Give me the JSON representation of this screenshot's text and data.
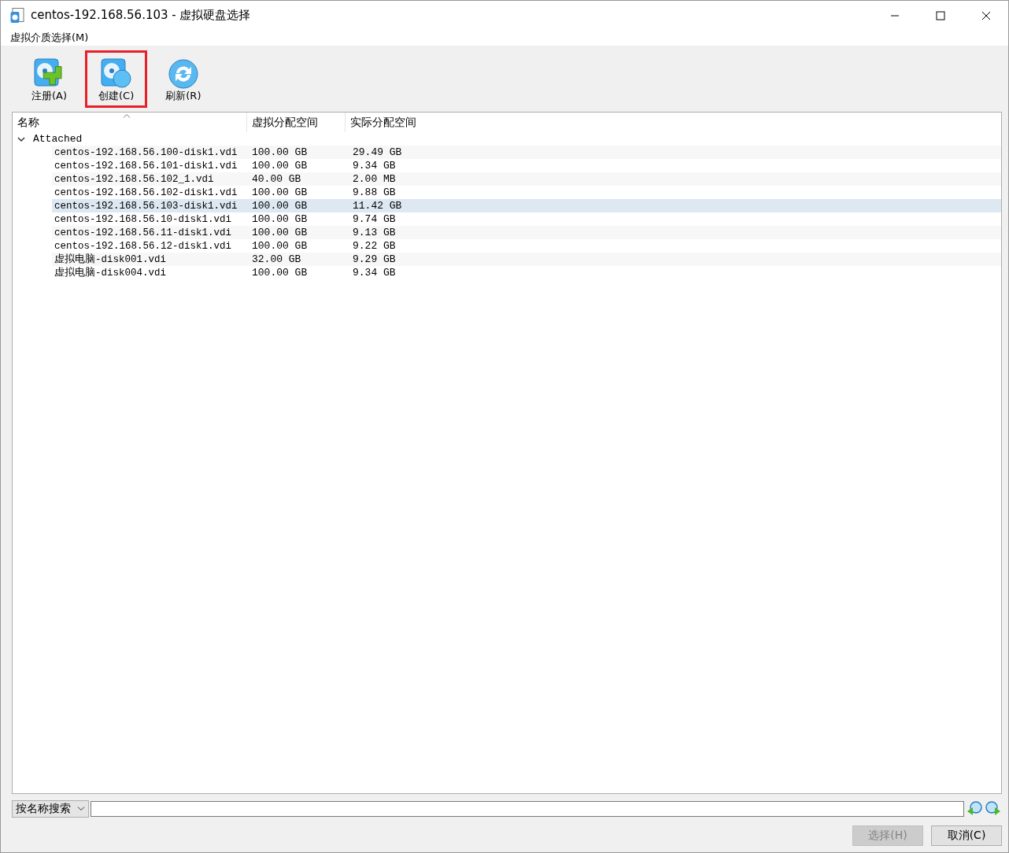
{
  "window": {
    "title": "centos-192.168.56.103 - 虚拟硬盘选择"
  },
  "menu": [
    {
      "label": "虚拟介质选择(M)"
    }
  ],
  "toolbar": [
    {
      "label": "注册(A)",
      "kind": "add",
      "highlighted": false
    },
    {
      "label": "创建(C)",
      "kind": "create",
      "highlighted": true
    },
    {
      "label": "刷新(R)",
      "kind": "refresh",
      "highlighted": false
    }
  ],
  "table": {
    "columns": [
      "名称",
      "虚拟分配空间",
      "实际分配空间"
    ],
    "groups": [
      {
        "label": "Attached",
        "expanded": true,
        "rows": [
          {
            "name": "centos-192.168.56.100-disk1.vdi",
            "virtual": "100.00 GB",
            "actual": "29.49 GB",
            "selected": false
          },
          {
            "name": "centos-192.168.56.101-disk1.vdi",
            "virtual": "100.00 GB",
            "actual": "9.34 GB",
            "selected": false
          },
          {
            "name": "centos-192.168.56.102_1.vdi",
            "virtual": "40.00 GB",
            "actual": "2.00 MB",
            "selected": false
          },
          {
            "name": "centos-192.168.56.102-disk1.vdi",
            "virtual": "100.00 GB",
            "actual": "9.88 GB",
            "selected": false
          },
          {
            "name": "centos-192.168.56.103-disk1.vdi",
            "virtual": "100.00 GB",
            "actual": "11.42 GB",
            "selected": true
          },
          {
            "name": "centos-192.168.56.10-disk1.vdi",
            "virtual": "100.00 GB",
            "actual": "9.74 GB",
            "selected": false
          },
          {
            "name": "centos-192.168.56.11-disk1.vdi",
            "virtual": "100.00 GB",
            "actual": "9.13 GB",
            "selected": false
          },
          {
            "name": "centos-192.168.56.12-disk1.vdi",
            "virtual": "100.00 GB",
            "actual": "9.22 GB",
            "selected": false
          },
          {
            "name": "虚拟电脑-disk001.vdi",
            "virtual": "32.00 GB",
            "actual": "9.29 GB",
            "selected": false
          },
          {
            "name": "虚拟电脑-disk004.vdi",
            "virtual": "100.00 GB",
            "actual": "9.34 GB",
            "selected": false
          }
        ]
      }
    ]
  },
  "search": {
    "mode": "按名称搜索"
  },
  "buttons": [
    {
      "label": "选择(H)",
      "disabled": true
    },
    {
      "label": "取消(C)",
      "disabled": false
    }
  ]
}
